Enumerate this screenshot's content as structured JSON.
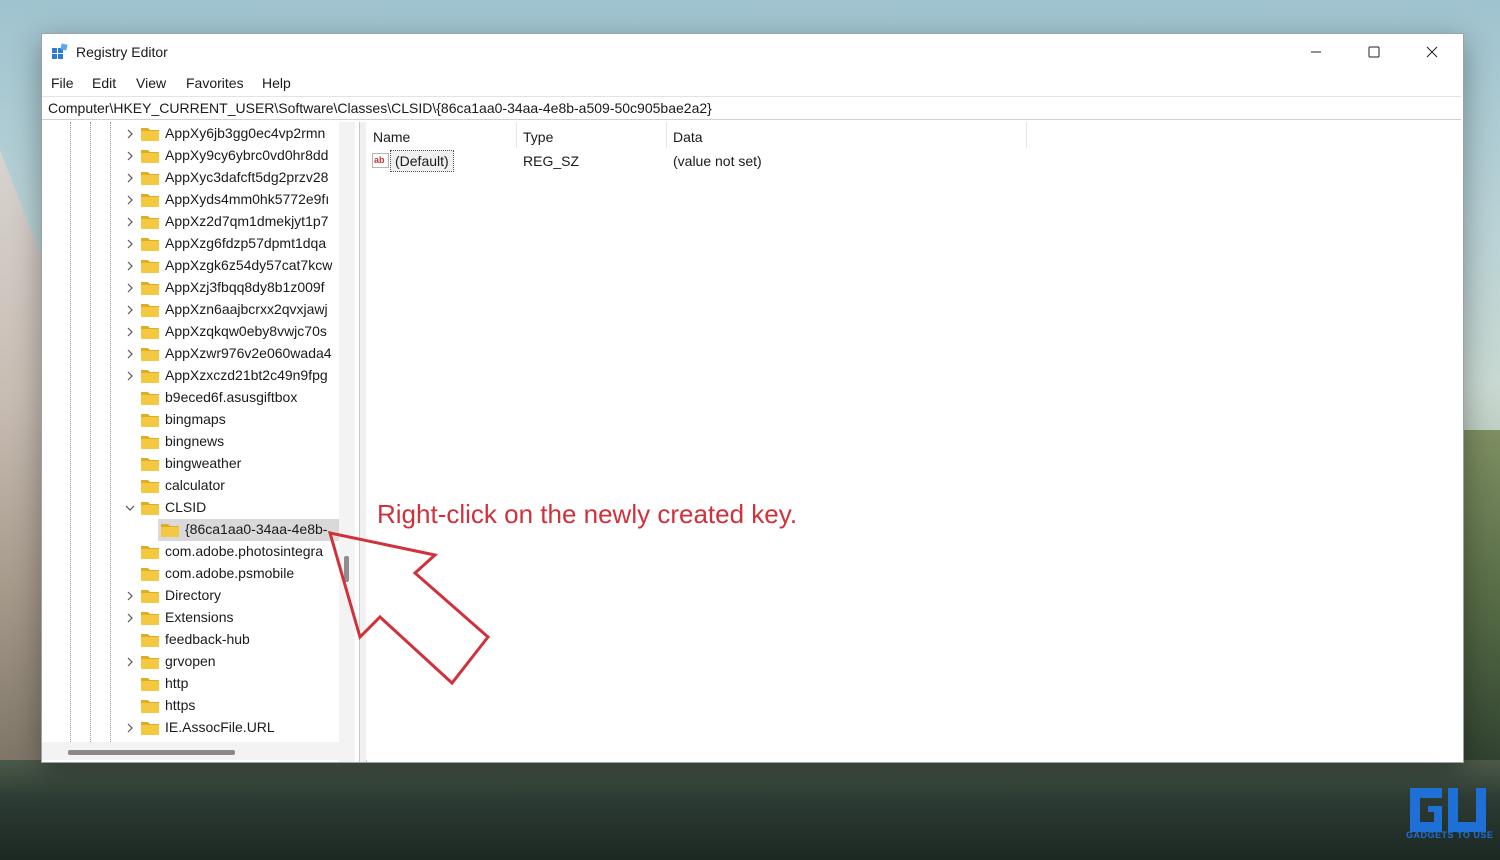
{
  "window": {
    "title": "Registry Editor",
    "minimize_icon": "minimize-icon",
    "maximize_icon": "maximize-icon",
    "close_icon": "close-icon"
  },
  "menu": [
    "File",
    "Edit",
    "View",
    "Favorites",
    "Help"
  ],
  "address": "Computer\\HKEY_CURRENT_USER\\Software\\Classes\\CLSID\\{86ca1aa0-34aa-4e8b-a509-50c905bae2a2}",
  "tree": {
    "items": [
      {
        "label": "AppXy6jb3gg0ec4vp2rmn",
        "expander": "collapsed"
      },
      {
        "label": "AppXy9cy6ybrc0vd0hr8dd",
        "expander": "collapsed"
      },
      {
        "label": "AppXyc3dafcft5dg2przv28",
        "expander": "collapsed"
      },
      {
        "label": "AppXyds4mm0hk5772e9fı",
        "expander": "collapsed"
      },
      {
        "label": "AppXz2d7qm1dmekjyt1p7",
        "expander": "collapsed"
      },
      {
        "label": "AppXzg6fdzp57dpmt1dqa",
        "expander": "collapsed"
      },
      {
        "label": "AppXzgk6z54dy57cat7kcw",
        "expander": "collapsed"
      },
      {
        "label": "AppXzj3fbqq8dy8b1z009f",
        "expander": "collapsed"
      },
      {
        "label": "AppXzn6aajbcrxx2qvxjawj",
        "expander": "collapsed"
      },
      {
        "label": "AppXzqkqw0eby8vwjc70s",
        "expander": "collapsed"
      },
      {
        "label": "AppXzwr976v2e060wada4",
        "expander": "collapsed"
      },
      {
        "label": "AppXzxczd21bt2c49n9fpg",
        "expander": "collapsed"
      },
      {
        "label": "b9eced6f.asusgiftbox",
        "expander": "none"
      },
      {
        "label": "bingmaps",
        "expander": "none"
      },
      {
        "label": "bingnews",
        "expander": "none"
      },
      {
        "label": "bingweather",
        "expander": "none"
      },
      {
        "label": "calculator",
        "expander": "none"
      },
      {
        "label": "CLSID",
        "expander": "expanded"
      },
      {
        "label": "{86ca1aa0-34aa-4e8b-",
        "expander": "none",
        "selected": true
      },
      {
        "label": "com.adobe.photosintegra",
        "expander": "none"
      },
      {
        "label": "com.adobe.psmobile",
        "expander": "none"
      },
      {
        "label": "Directory",
        "expander": "collapsed"
      },
      {
        "label": "Extensions",
        "expander": "collapsed"
      },
      {
        "label": "feedback-hub",
        "expander": "none"
      },
      {
        "label": "grvopen",
        "expander": "collapsed"
      },
      {
        "label": "http",
        "expander": "none"
      },
      {
        "label": "https",
        "expander": "none"
      },
      {
        "label": "IE.AssocFile.URL",
        "expander": "collapsed"
      }
    ]
  },
  "values": {
    "columns": [
      "Name",
      "Type",
      "Data"
    ],
    "rows": [
      {
        "name": "(Default)",
        "type": "REG_SZ",
        "data": "(value not set)",
        "icon": "string-value-icon"
      }
    ]
  },
  "annotation": "Right-click on the newly created key.",
  "colors": {
    "annotation": "#d0313b",
    "folder": "#f5c842",
    "selection": "#d9d9d9",
    "watermark": "#1e6fd6"
  },
  "watermark": {
    "text": "GADGETS TO USE"
  }
}
